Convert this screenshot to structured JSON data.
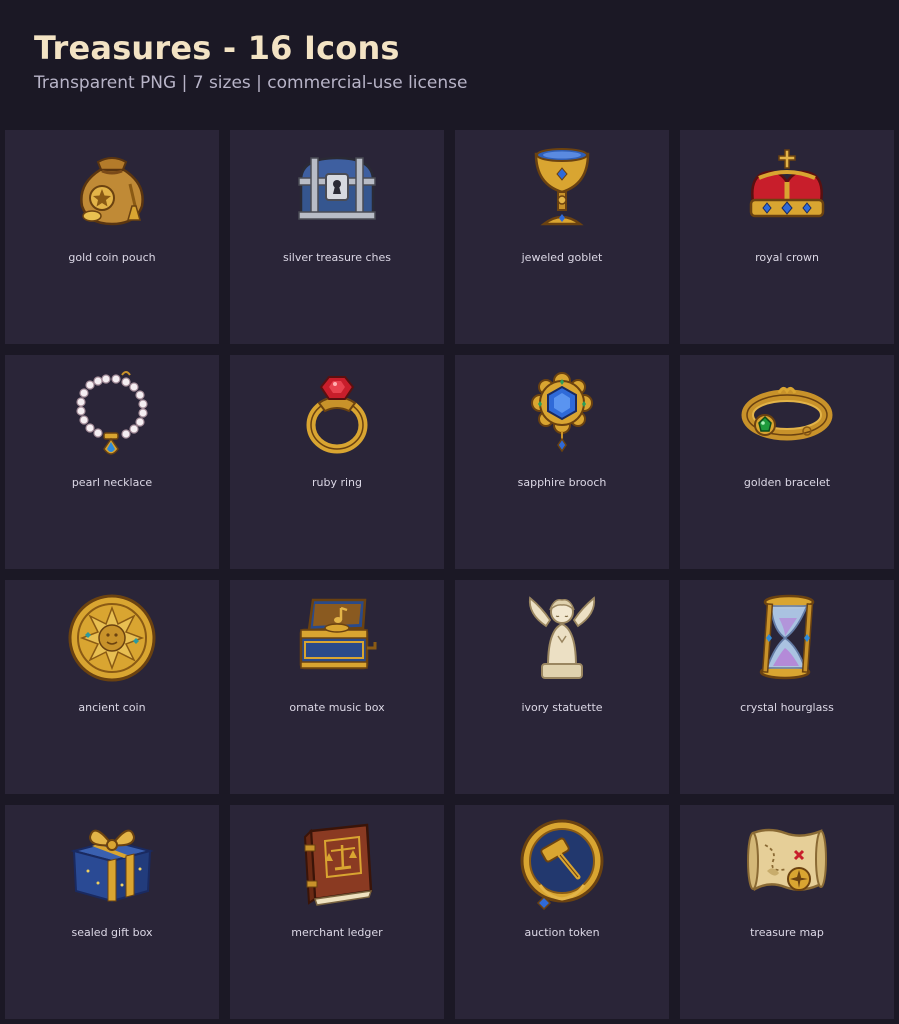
{
  "header": {
    "title": "Treasures - 16 Icons",
    "subtitle": "Transparent PNG | 7 sizes | commercial-use license"
  },
  "items": [
    {
      "label": "gold coin pouch",
      "icon": "gold-coin-pouch-icon"
    },
    {
      "label": "silver treasure ches",
      "icon": "treasure-chest-icon"
    },
    {
      "label": "jeweled goblet",
      "icon": "goblet-icon"
    },
    {
      "label": "royal crown",
      "icon": "crown-icon"
    },
    {
      "label": "pearl necklace",
      "icon": "pearl-necklace-icon"
    },
    {
      "label": "ruby ring",
      "icon": "ruby-ring-icon"
    },
    {
      "label": "sapphire brooch",
      "icon": "sapphire-brooch-icon"
    },
    {
      "label": "golden bracelet",
      "icon": "golden-bracelet-icon"
    },
    {
      "label": "ancient coin",
      "icon": "ancient-coin-icon"
    },
    {
      "label": "ornate music box",
      "icon": "music-box-icon"
    },
    {
      "label": "ivory statuette",
      "icon": "angel-statuette-icon"
    },
    {
      "label": "crystal hourglass",
      "icon": "hourglass-icon"
    },
    {
      "label": "sealed gift box",
      "icon": "gift-box-icon"
    },
    {
      "label": "merchant ledger",
      "icon": "ledger-book-icon"
    },
    {
      "label": "auction token",
      "icon": "gavel-token-icon"
    },
    {
      "label": "treasure map",
      "icon": "treasure-map-icon"
    }
  ],
  "colors": {
    "background": "#1b1825",
    "card": "#2a2538",
    "title": "#f3e3c4",
    "subtitle": "#b8b4c8",
    "label": "#dcd8e6",
    "gold": "#d9a531",
    "sapphire": "#2f6ad8",
    "ruby": "#c81e2b"
  }
}
